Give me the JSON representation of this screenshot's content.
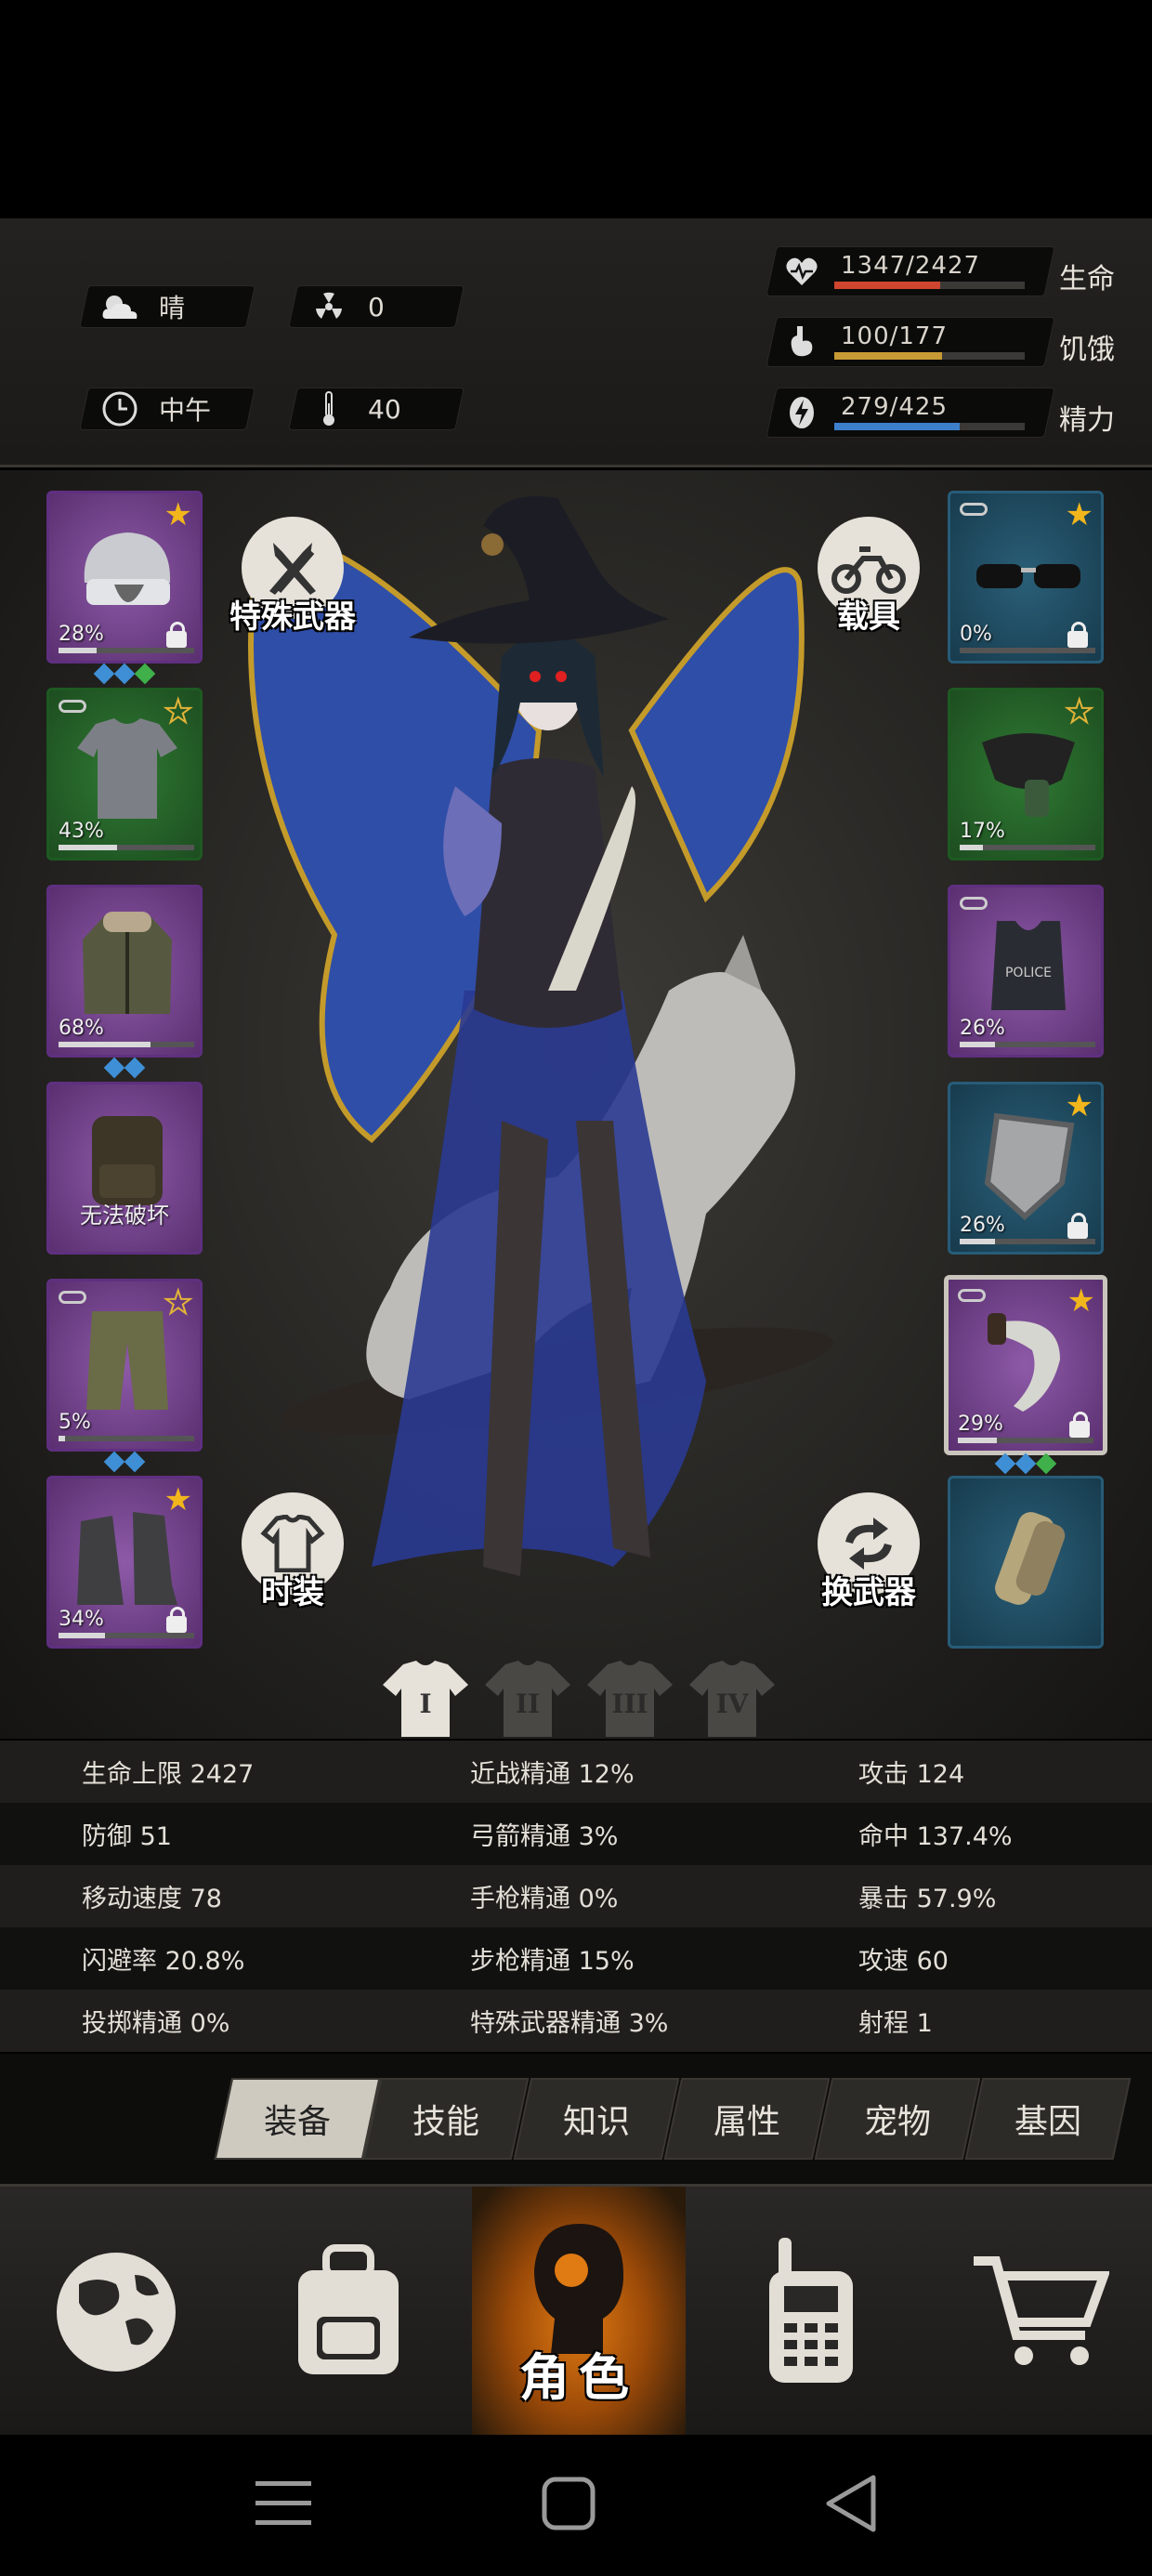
{
  "header": {
    "weather": "晴",
    "radiation": "0",
    "time_of_day": "中午",
    "temperature": "40",
    "stats": [
      {
        "name": "health",
        "label": "生命",
        "value": "1347/2427",
        "current": 1347,
        "max": 2427,
        "color": "#d0452f"
      },
      {
        "name": "hunger",
        "label": "饥饿",
        "value": "100/177",
        "current": 100,
        "max": 177,
        "color": "#c89a35"
      },
      {
        "name": "energy",
        "label": "精力",
        "value": "279/425",
        "current": 279,
        "max": 425,
        "color": "#3d7fcb"
      }
    ]
  },
  "equipment": {
    "left": [
      {
        "name": "helmet",
        "pct": "28%",
        "durability": 0.28,
        "star": "gold",
        "rarity": "purple",
        "locked": true,
        "gems": [
          "blue",
          "blue",
          "green"
        ]
      },
      {
        "name": "tshirt",
        "pct": "43%",
        "durability": 0.43,
        "star": "empty",
        "rarity": "green",
        "linked": true
      },
      {
        "name": "jacket",
        "pct": "68%",
        "durability": 0.68,
        "rarity": "purple",
        "gems": [
          "blue",
          "blue"
        ]
      },
      {
        "name": "backpack",
        "broken_text": "无法破坏",
        "rarity": "purple"
      },
      {
        "name": "pants",
        "pct": "5%",
        "durability": 0.05,
        "star": "empty",
        "rarity": "purple",
        "linked": true,
        "gems": [
          "blue",
          "blue"
        ]
      },
      {
        "name": "boots",
        "pct": "34%",
        "durability": 0.34,
        "star": "gold",
        "rarity": "purple",
        "locked": true
      }
    ],
    "right": [
      {
        "name": "sunglasses",
        "pct": "0%",
        "durability": 0.0,
        "star": "gold",
        "rarity": "blue",
        "locked": true,
        "linked": true
      },
      {
        "name": "mask",
        "pct": "17%",
        "durability": 0.17,
        "star": "empty",
        "rarity": "green"
      },
      {
        "name": "police-vest",
        "pct": "26%",
        "durability": 0.26,
        "rarity": "purple",
        "linked": true
      },
      {
        "name": "shield",
        "pct": "26%",
        "durability": 0.26,
        "star": "gold",
        "rarity": "blue",
        "locked": true
      },
      {
        "name": "machete",
        "pct": "29%",
        "durability": 0.29,
        "star": "gold",
        "rarity": "purple",
        "locked": true,
        "linked": true,
        "selected": true,
        "gems": [
          "blue",
          "blue",
          "green"
        ]
      },
      {
        "name": "bandage",
        "rarity": "blue"
      }
    ]
  },
  "actions": {
    "special_weapon": "特殊武器",
    "vehicle": "载具",
    "fashion": "时装",
    "swap_weapon": "换武器"
  },
  "outfit_tabs": [
    "I",
    "II",
    "III",
    "IV"
  ],
  "attributes": [
    [
      "生命上限 2427",
      "近战精通 12%",
      "攻击 124"
    ],
    [
      "防御 51",
      "弓箭精通 3%",
      "命中 137.4%"
    ],
    [
      "移动速度 78",
      "手枪精通 0%",
      "暴击 57.9%"
    ],
    [
      "闪避率 20.8%",
      "步枪精通 15%",
      "攻速 60"
    ],
    [
      "投掷精通 0%",
      "特殊武器精通 3%",
      "射程 1"
    ]
  ],
  "subtabs": [
    "装备",
    "技能",
    "知识",
    "属性",
    "宠物",
    "基因"
  ],
  "bottom_nav": {
    "active_label": "角色",
    "items": [
      "globe-icon",
      "backpack-icon",
      "character-icon",
      "radio-icon",
      "cart-icon"
    ]
  }
}
